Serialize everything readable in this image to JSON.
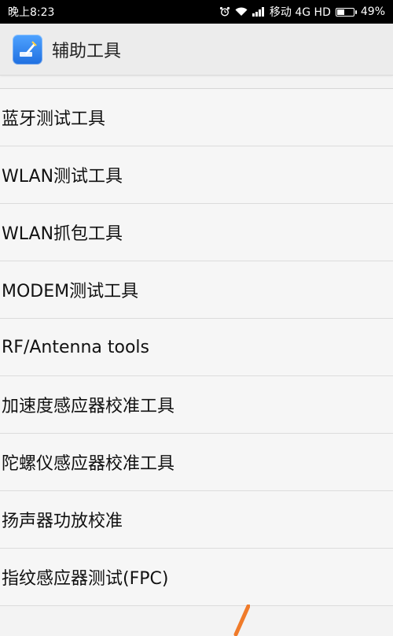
{
  "status_bar": {
    "time": "晚上8:23",
    "carrier": "移动 4G HD",
    "battery_percent": "49%",
    "battery_level": 0.49,
    "icons": [
      "alarm-icon",
      "wifi-icon",
      "signal-icon",
      "battery-icon"
    ]
  },
  "app_bar": {
    "title": "辅助工具",
    "icon": "tools-app-icon"
  },
  "list": {
    "items": [
      {
        "label": "蓝牙测试工具"
      },
      {
        "label": "WLAN测试工具"
      },
      {
        "label": "WLAN抓包工具"
      },
      {
        "label": "MODEM测试工具"
      },
      {
        "label": "RF/Antenna tools"
      },
      {
        "label": "加速度感应器校准工具"
      },
      {
        "label": "陀螺仪感应器校准工具"
      },
      {
        "label": "扬声器功放校准"
      },
      {
        "label": "指纹感应器测试(FPC)"
      }
    ]
  },
  "colors": {
    "status_bar_bg": "#000000",
    "app_bar_bg": "#ececec",
    "list_bg": "#f6f6f6",
    "annotation_stroke": "#f07b2a"
  }
}
